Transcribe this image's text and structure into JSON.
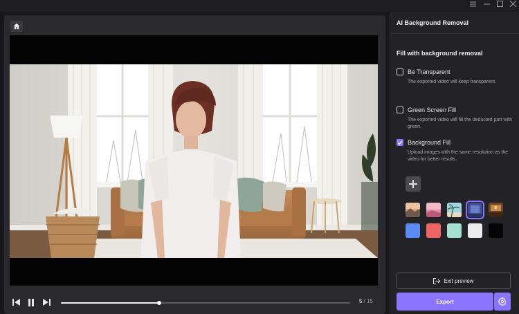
{
  "panel": {
    "title": "AI Background Removal",
    "section_title": "Fill with background removal",
    "options": [
      {
        "label": "Be Transparent",
        "desc": "The exported video will keep transparent.",
        "checked": false
      },
      {
        "label": "Green Screen Fill",
        "desc": "The exported video will fill the deducted part with green.",
        "checked": false
      },
      {
        "label": "Background Fill",
        "desc": "Upload images with the same resolution as the video for better results.",
        "checked": true
      }
    ],
    "add_icon": "plus-icon",
    "image_swatches": [
      "landscape-sunset",
      "pink-sky",
      "beach-palm",
      "blue-room",
      "wooden-interior"
    ],
    "selected_swatch": "blue-room",
    "color_swatches": [
      "#5b8cf5",
      "#ef6464",
      "#a6e0cf",
      "#ececec",
      "#050505"
    ],
    "exit_label": "Exit preview",
    "export_label": "Export"
  },
  "player": {
    "current": "5",
    "total": "/ 15",
    "progress": 0.34
  },
  "colors": {
    "accent": "#8a73ff",
    "panel_bg": "#232327",
    "player_bg": "#2a2a2e"
  }
}
